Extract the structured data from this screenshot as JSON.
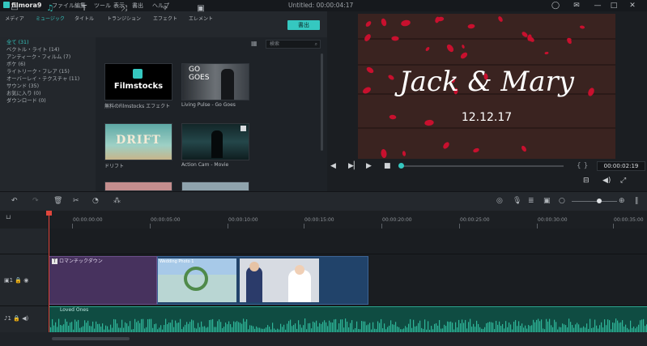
{
  "app": {
    "name": "filmora9",
    "document_title": "Untitled: 00:00:04:17"
  },
  "menu": [
    "ファイル",
    "編集",
    "ツール",
    "表示",
    "書出",
    "ヘルプ"
  ],
  "tabs": [
    {
      "label": "メディア",
      "icon": "folder-icon"
    },
    {
      "label": "ミュージック",
      "icon": "music-note-icon"
    },
    {
      "label": "タイトル",
      "icon": "text-icon"
    },
    {
      "label": "トランジション",
      "icon": "transition-icon"
    },
    {
      "label": "エフェクト",
      "icon": "effects-icon"
    },
    {
      "label": "エレメント",
      "icon": "image-icon"
    }
  ],
  "import_button": "書出",
  "categories": [
    "全て (31)",
    "ベクトル・ライト (14)",
    "アンティーク・フィルム (7)",
    "ボケ (6)",
    "ライトリーク・フレア (15)",
    "オーバーレイ・テクスチャ (11)",
    "サウンド (35)",
    "お気に入り (0)",
    "ダウンロード (0)"
  ],
  "search": {
    "placeholder": "検索"
  },
  "media_items": [
    {
      "label": "無料のFilmstocks エフェクト",
      "thumb_text": "Filmstocks"
    },
    {
      "label": "Living Pulse - Go Goes",
      "thumb_text": "GO GOES"
    },
    {
      "label": "ドリフト",
      "thumb_text": "DRIFT"
    },
    {
      "label": "Action Cam - Movie",
      "thumb_text": ""
    }
  ],
  "preview": {
    "line1": "Jack & Mary",
    "line2": "12.12.17"
  },
  "timecode": "00:00:02:19",
  "ruler_ticks": [
    "00:00:00:00",
    "00:00:05:00",
    "00:00:10:00",
    "00:00:15:00",
    "00:00:20:00",
    "00:00:25:00",
    "00:00:30:00",
    "00:00:35:00"
  ],
  "timeline": {
    "title_clip_label": "ロマンチックダウン",
    "photo1_label": "Wedding Photo 1",
    "audio_label": "Loved Ones"
  }
}
